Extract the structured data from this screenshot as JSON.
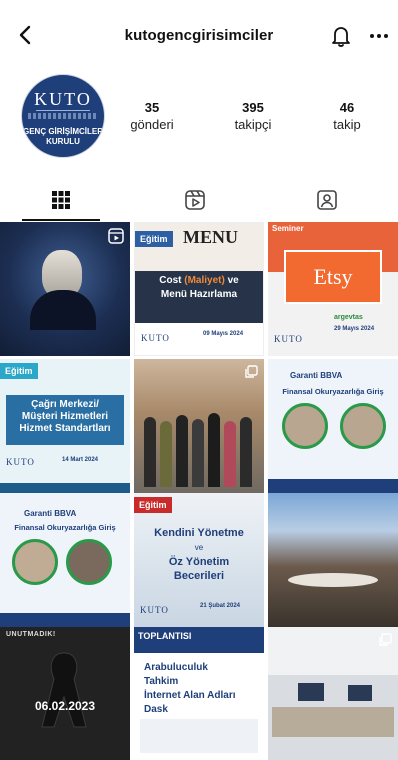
{
  "header": {
    "username": "kutogencgirisimciler"
  },
  "profile": {
    "avatar": {
      "logo_text": "KUTO",
      "club_line1": "GENÇ GİRİŞİMCİLER",
      "club_line2": "KURULU"
    },
    "stats": [
      {
        "value": "35",
        "label": "gönderi"
      },
      {
        "value": "395",
        "label": "takipçi"
      },
      {
        "value": "46",
        "label": "takip"
      }
    ]
  },
  "tabs": [
    {
      "name": "grid",
      "active": true
    },
    {
      "name": "reels",
      "active": false
    },
    {
      "name": "tagged",
      "active": false
    }
  ],
  "posts": {
    "p2": {
      "label": "Eğitim",
      "menu": "MENU",
      "line1_pre": "Cost ",
      "line1_accent": "(Maliyet)",
      "line1_post": " ve",
      "line2": "Menü Hazırlama",
      "date": "09 Mayıs 2024",
      "kuto": "KUTO"
    },
    "p3": {
      "label": "Seminer",
      "brand": "Etsy",
      "sponsor": "argevtas",
      "date": "29 Mayıs 2024",
      "kuto": "KUTO"
    },
    "p4": {
      "label": "Eğitim",
      "line1": "Çağrı Merkezi/",
      "line2": "Müşteri Hizmetleri",
      "line3": "Hizmet Standartları",
      "date": "14 Mart 2024",
      "kuto": "KUTO"
    },
    "p6": {
      "bank": "Garanti BBVA",
      "title": "Finansal Okuryazarlığa Giriş"
    },
    "p7": {
      "bank": "Garanti BBVA",
      "title": "Finansal Okuryazarlığa Giriş"
    },
    "p8": {
      "label": "Eğitim",
      "line1": "Kendini Yönetme",
      "conj": "ve",
      "line2": "Öz Yönetim",
      "line3": "Becerileri",
      "date": "21 Şubat 2024",
      "kuto": "KUTO"
    },
    "p10": {
      "top": "UNUTMADIK!",
      "date": "06.02.2023"
    },
    "p11": {
      "top": "TOPLANTISI",
      "items": [
        "Arabuluculuk",
        "Tahkim",
        "İnternet Alan Adları",
        "Dask"
      ]
    }
  },
  "colors": {
    "brand_blue": "#1f3f7a",
    "accent_orange": "#f26a2f",
    "tag_red": "#c92a2a",
    "tag_cyan": "#2aa7c9"
  },
  "icons": {
    "back": "chevron-left-icon",
    "bell": "bell-icon",
    "more": "more-horizontal-icon",
    "grid": "grid-icon",
    "reels": "reels-icon",
    "tagged": "tagged-person-icon"
  }
}
